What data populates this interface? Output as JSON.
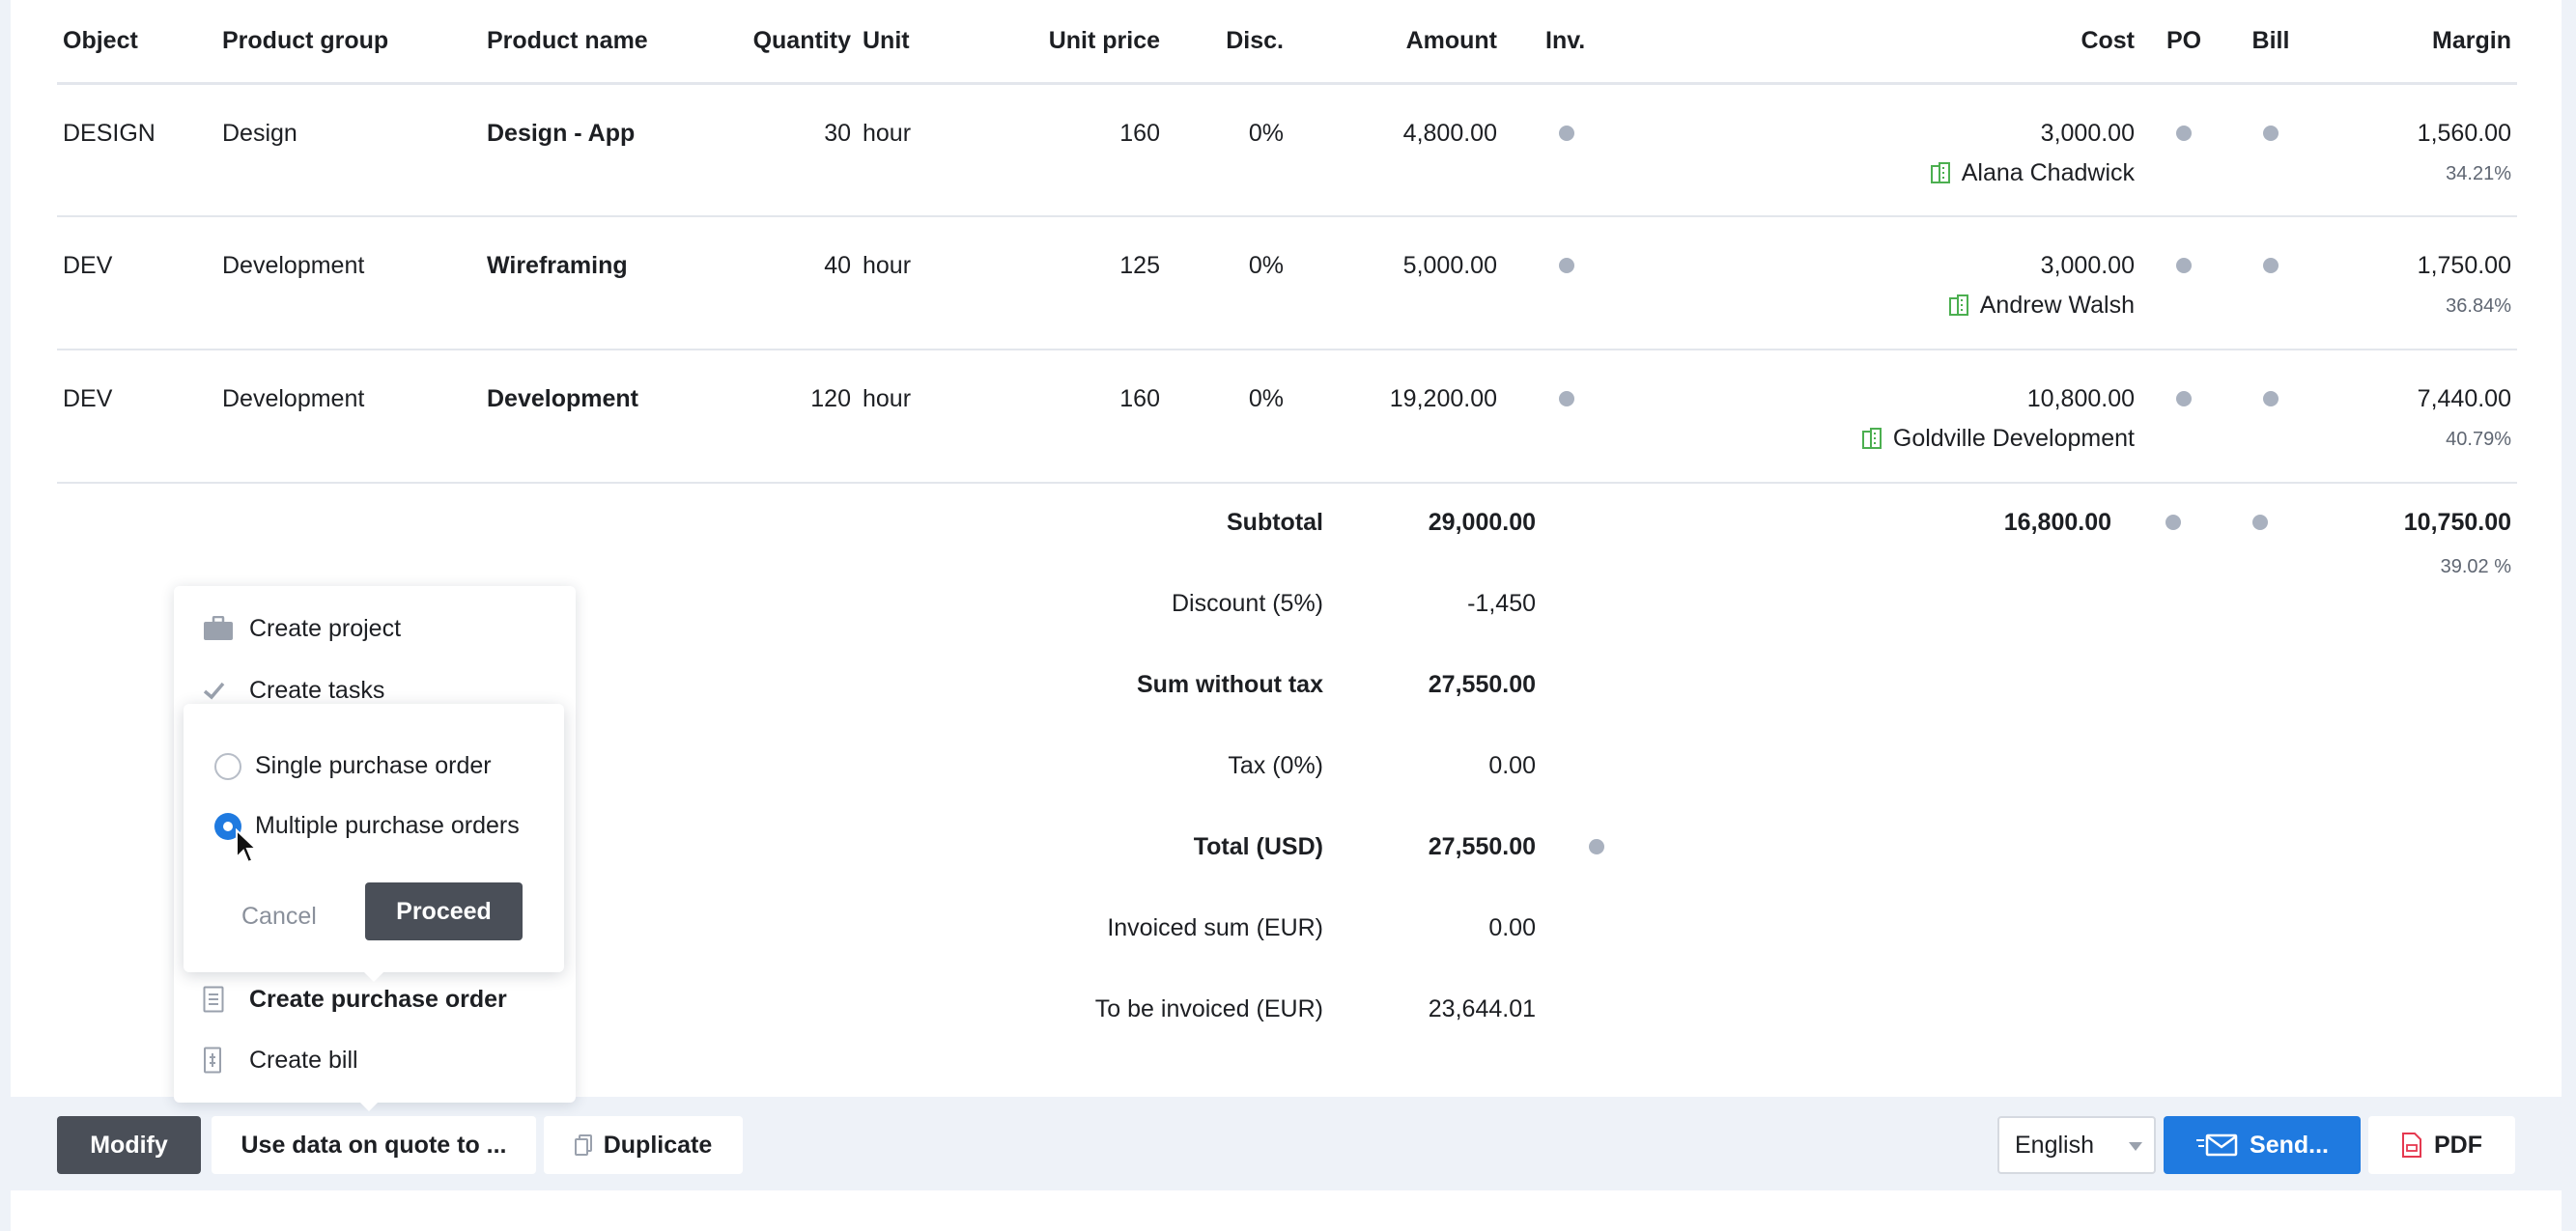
{
  "table": {
    "headers": {
      "object": "Object",
      "product_group": "Product group",
      "product_name": "Product name",
      "quantity": "Quantity",
      "unit": "Unit",
      "unit_price": "Unit price",
      "disc": "Disc.",
      "amount": "Amount",
      "inv": "Inv.",
      "cost": "Cost",
      "po": "PO",
      "bill": "Bill",
      "margin": "Margin"
    },
    "rows": [
      {
        "object": "DESIGN",
        "product_group": "Design",
        "product_name": "Design - App",
        "quantity": "30",
        "unit": "hour",
        "unit_price": "160",
        "disc": "0%",
        "amount": "4,800.00",
        "cost": "3,000.00",
        "supplier": "Alana Chadwick",
        "margin": "1,560.00",
        "margin_pct": "34.21%"
      },
      {
        "object": "DEV",
        "product_group": "Development",
        "product_name": "Wireframing",
        "quantity": "40",
        "unit": "hour",
        "unit_price": "125",
        "disc": "0%",
        "amount": "5,000.00",
        "cost": "3,000.00",
        "supplier": "Andrew Walsh",
        "margin": "1,750.00",
        "margin_pct": "36.84%"
      },
      {
        "object": "DEV",
        "product_group": "Development",
        "product_name": "Development",
        "quantity": "120",
        "unit": "hour",
        "unit_price": "160",
        "disc": "0%",
        "amount": "19,200.00",
        "cost": "10,800.00",
        "supplier": "Goldville Development",
        "margin": "7,440.00",
        "margin_pct": "40.79%"
      }
    ]
  },
  "summary": {
    "subtotal_label": "Subtotal",
    "subtotal_amount": "29,000.00",
    "subtotal_cost": "16,800.00",
    "subtotal_margin": "10,750.00",
    "subtotal_margin_pct": "39.02 %",
    "discount_label": "Discount (5%)",
    "discount_value": "-1,450",
    "sum_wo_tax_label": "Sum without tax",
    "sum_wo_tax_value": "27,550.00",
    "tax_label": "Tax (0%)",
    "tax_value": "0.00",
    "total_label": "Total (USD)",
    "total_value": "27,550.00",
    "invoiced_label": "Invoiced sum (EUR)",
    "invoiced_value": "0.00",
    "to_invoice_label": "To be invoiced (EUR)",
    "to_invoice_value": "23,644.01"
  },
  "menu": {
    "create_project": "Create project",
    "create_tasks": "Create tasks",
    "create_purchase_order": "Create purchase order",
    "create_bill": "Create bill"
  },
  "popup": {
    "single_po": "Single purchase order",
    "multiple_po": "Multiple purchase orders",
    "selected": "multiple",
    "cancel": "Cancel",
    "proceed": "Proceed"
  },
  "toolbar": {
    "modify": "Modify",
    "use_data": "Use data on quote to ...",
    "duplicate": "Duplicate",
    "language": "English",
    "send": "Send...",
    "pdf": "PDF"
  },
  "colors": {
    "accent": "#1f7ae0",
    "dark_button": "#4a4f58",
    "status_dot": "#a9b1bf",
    "supplier_icon": "#4caf50",
    "pdf_icon": "#e53950"
  },
  "icons": {
    "supplier": "building-icon",
    "project": "briefcase-icon",
    "tasks": "checkmark-icon",
    "purchase_order": "document-icon",
    "bill": "receipt-icon",
    "duplicate": "copy-icon",
    "send": "mail-send-icon",
    "pdf": "pdf-icon"
  }
}
